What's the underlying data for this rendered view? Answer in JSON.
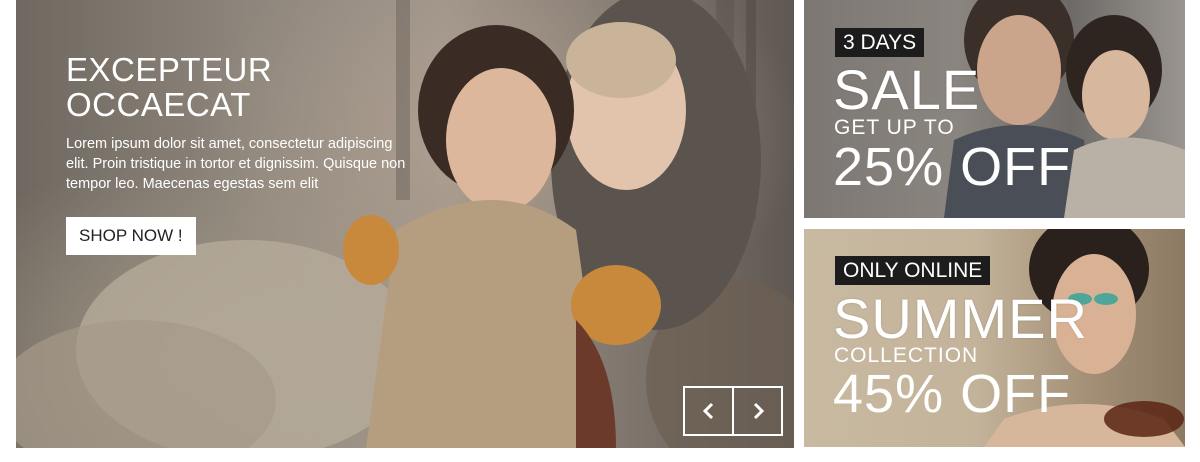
{
  "hero": {
    "title_line1": "EXCEPTEUR",
    "title_line2": "OCCAECAT",
    "description": "Lorem ipsum dolor sit amet, consectetur adipiscing elit. Proin tristique in tortor et dignissim. Quisque non tempor leo. Maecenas egestas sem elit",
    "button_label": "SHOP NOW !",
    "prev_icon": "chevron-left-icon",
    "next_icon": "chevron-right-icon"
  },
  "promo_top": {
    "tag": "3 DAYS",
    "headline": "SALE",
    "subline": "GET UP TO",
    "discount": "25% OFF"
  },
  "promo_bottom": {
    "tag": "ONLY ONLINE",
    "headline": "SUMMER",
    "subline": "COLLECTION",
    "discount": "45% OFF"
  },
  "colors": {
    "tag_background": "#1c1c1c",
    "text": "#ffffff",
    "button_background": "#ffffff"
  }
}
